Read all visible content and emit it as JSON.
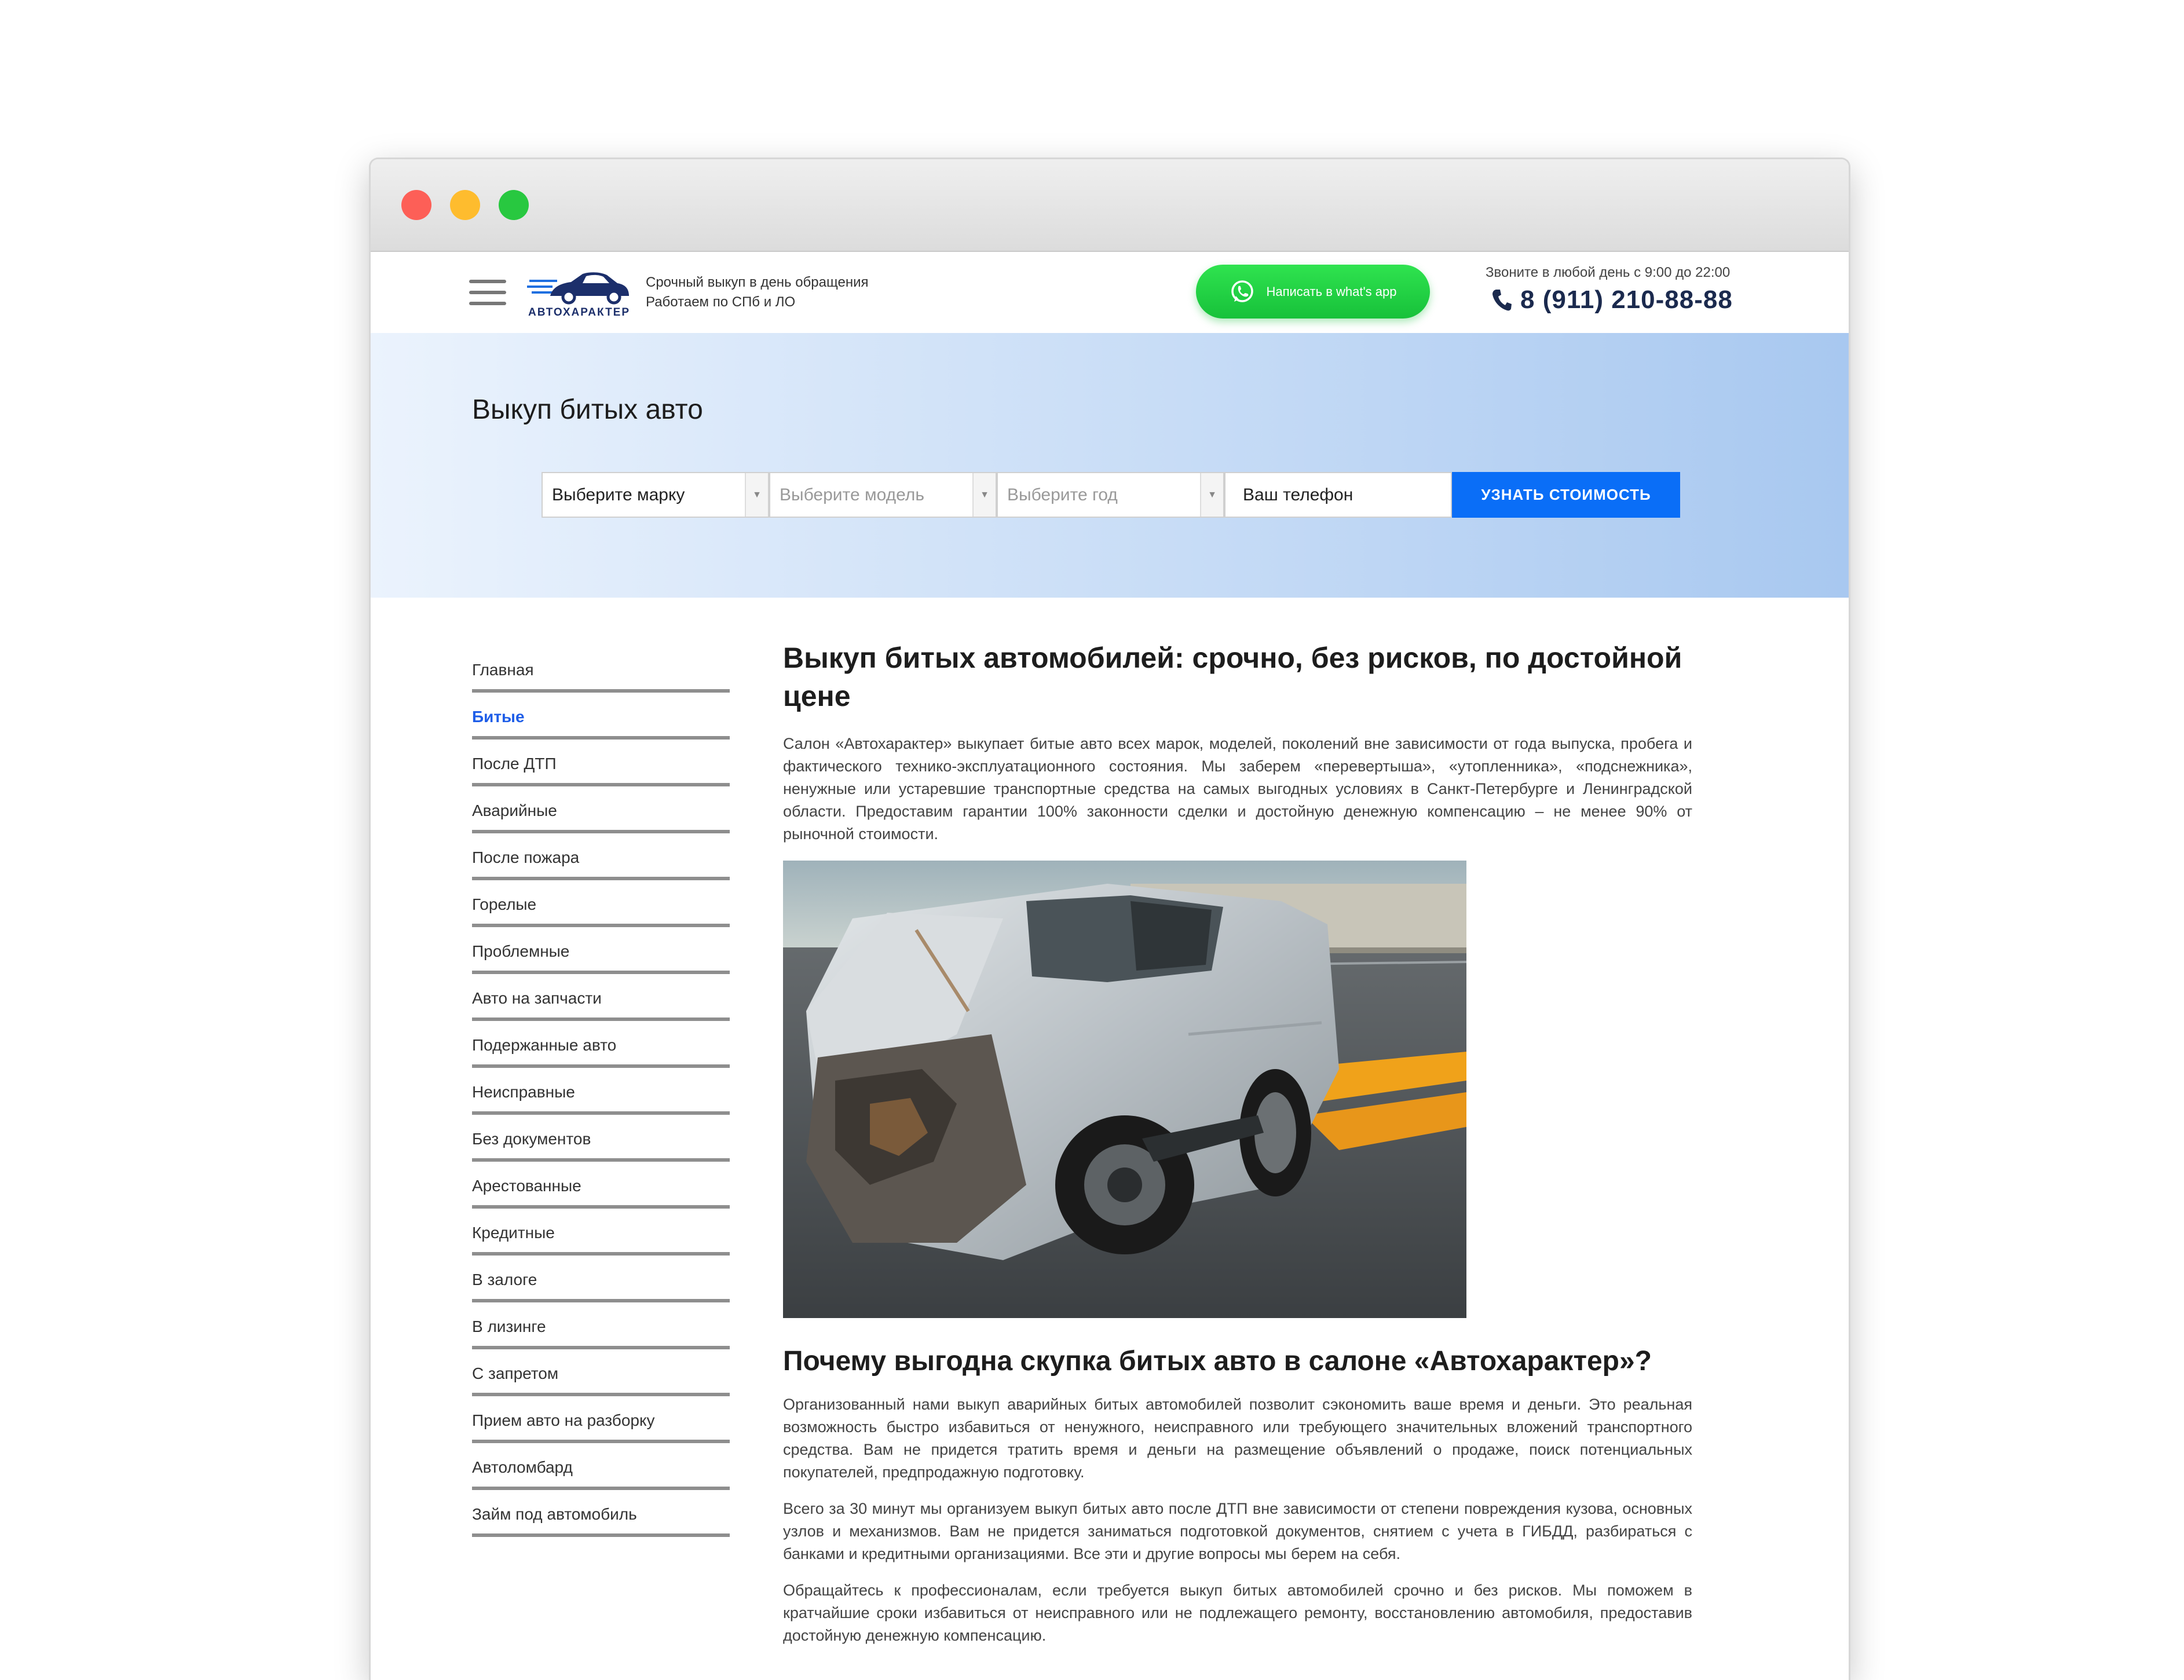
{
  "header": {
    "logo_text": "АВТОХАРАКТЕР",
    "tagline_line1": "Срочный выкуп в день обращения",
    "tagline_line2": "Работаем по СПб и ЛО",
    "whatsapp_label": "Написать в what's app",
    "call_note": "Звоните в любой день с 9:00 до 22:00",
    "phone": "8 (911) 210-88-88"
  },
  "hero": {
    "title": "Выкуп битых авто",
    "brand_select": "Выберите марку",
    "model_select": "Выберите модель",
    "year_select": "Выберите год",
    "phone_placeholder": "Ваш телефон",
    "submit_label": "УЗНАТЬ СТОИМОСТЬ"
  },
  "sidebar": {
    "items": [
      {
        "label": "Главная"
      },
      {
        "label": "Битые"
      },
      {
        "label": "После ДТП"
      },
      {
        "label": "Аварийные"
      },
      {
        "label": "После пожара"
      },
      {
        "label": "Горелые"
      },
      {
        "label": "Проблемные"
      },
      {
        "label": "Авто на запчасти"
      },
      {
        "label": "Подержанные авто"
      },
      {
        "label": "Неисправные"
      },
      {
        "label": "Без документов"
      },
      {
        "label": "Арестованные"
      },
      {
        "label": "Кредитные"
      },
      {
        "label": "В залоге"
      },
      {
        "label": "В лизинге"
      },
      {
        "label": "С запретом"
      },
      {
        "label": "Прием авто на разборку"
      },
      {
        "label": "Автоломбард"
      },
      {
        "label": "Займ под автомобиль"
      }
    ],
    "active_index": 1
  },
  "content": {
    "heading": "Выкуп битых автомобилей: срочно, без рисков, по достойной цене",
    "intro": "Салон «Автохарактер» выкупает битые авто всех марок, моделей, поколений вне зависимости от года выпуска, пробега и фактического технико-эксплуатационного состояния. Мы заберем «перевертыша», «утопленника», «подснежника», ненужные или устаревшие транспортные средства на самых выгодных условиях в Санкт-Петербурге и Ленинградской области. Предоставим гарантии 100% законности сделки и достойную денежную компенсацию – не менее 90% от рыночной стоимости.",
    "subheading": "Почему выгодна скупка битых авто в салоне «Автохарактер»?",
    "paragraphs": [
      "Организованный нами выкуп аварийных битых автомобилей позволит сэкономить ваше время и деньги. Это реальная возможность быстро избавиться от ненужного, неисправного или требующего значительных вложений транспортного средства. Вам не придется тратить время и деньги на размещение объявлений о продаже, поиск потенциальных покупателей, предпродажную подготовку.",
      "Всего за 30 минут мы организуем выкуп битых авто после ДТП вне зависимости от степени повреждения кузова, основных узлов и механизмов. Вам не придется заниматься подготовкой документов, снятием с учета в ГИБДД, разбираться с банками и кредитными организациями. Все эти и другие вопросы мы берем на себя.",
      "Обращайтесь к профессионалам, если требуется выкуп битых автомобилей срочно и без рисков. Мы поможем в кратчайшие сроки избавиться от неисправного или не подлежащего ремонту, восстановлению автомобиля, предоставив достойную денежную компенсацию."
    ]
  }
}
